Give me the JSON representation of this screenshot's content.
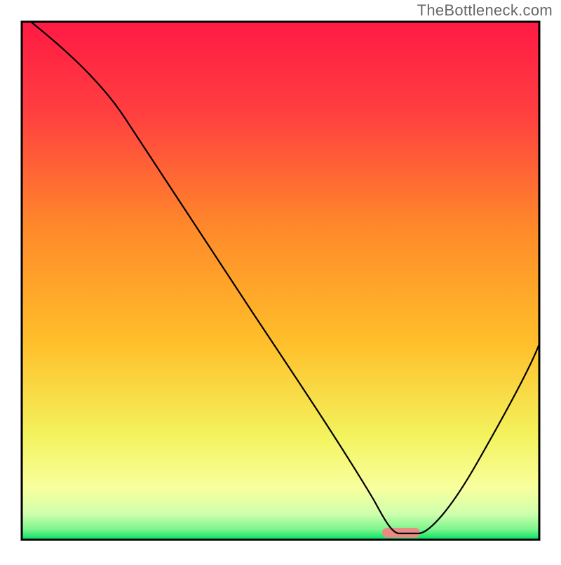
{
  "watermark": "TheBottleneck.com",
  "chart_data": {
    "type": "line",
    "title": "",
    "xlabel": "",
    "ylabel": "",
    "xlim": [
      0,
      100
    ],
    "ylim": [
      0,
      100
    ],
    "grid": false,
    "axes_visible": false,
    "background_gradient": {
      "top_color": "#ff1a44",
      "mid_color": "#ffcc33",
      "lower_color": "#f5ff66",
      "bottom_color": "#00e060"
    },
    "series": [
      {
        "name": "bottleneck-curve",
        "color": "#000000",
        "x": [
          2,
          10,
          20,
          30,
          40,
          50,
          60,
          66,
          70,
          74,
          76,
          80,
          88,
          96
        ],
        "y": [
          100,
          90,
          78,
          67,
          54,
          41,
          27,
          15,
          6,
          1.5,
          1.5,
          6,
          21,
          38
        ]
      }
    ],
    "marker": {
      "name": "optimal-range",
      "color": "#e88b85",
      "x_start": 70,
      "x_end": 76,
      "y": 1.5,
      "shape": "rounded-bar"
    }
  }
}
